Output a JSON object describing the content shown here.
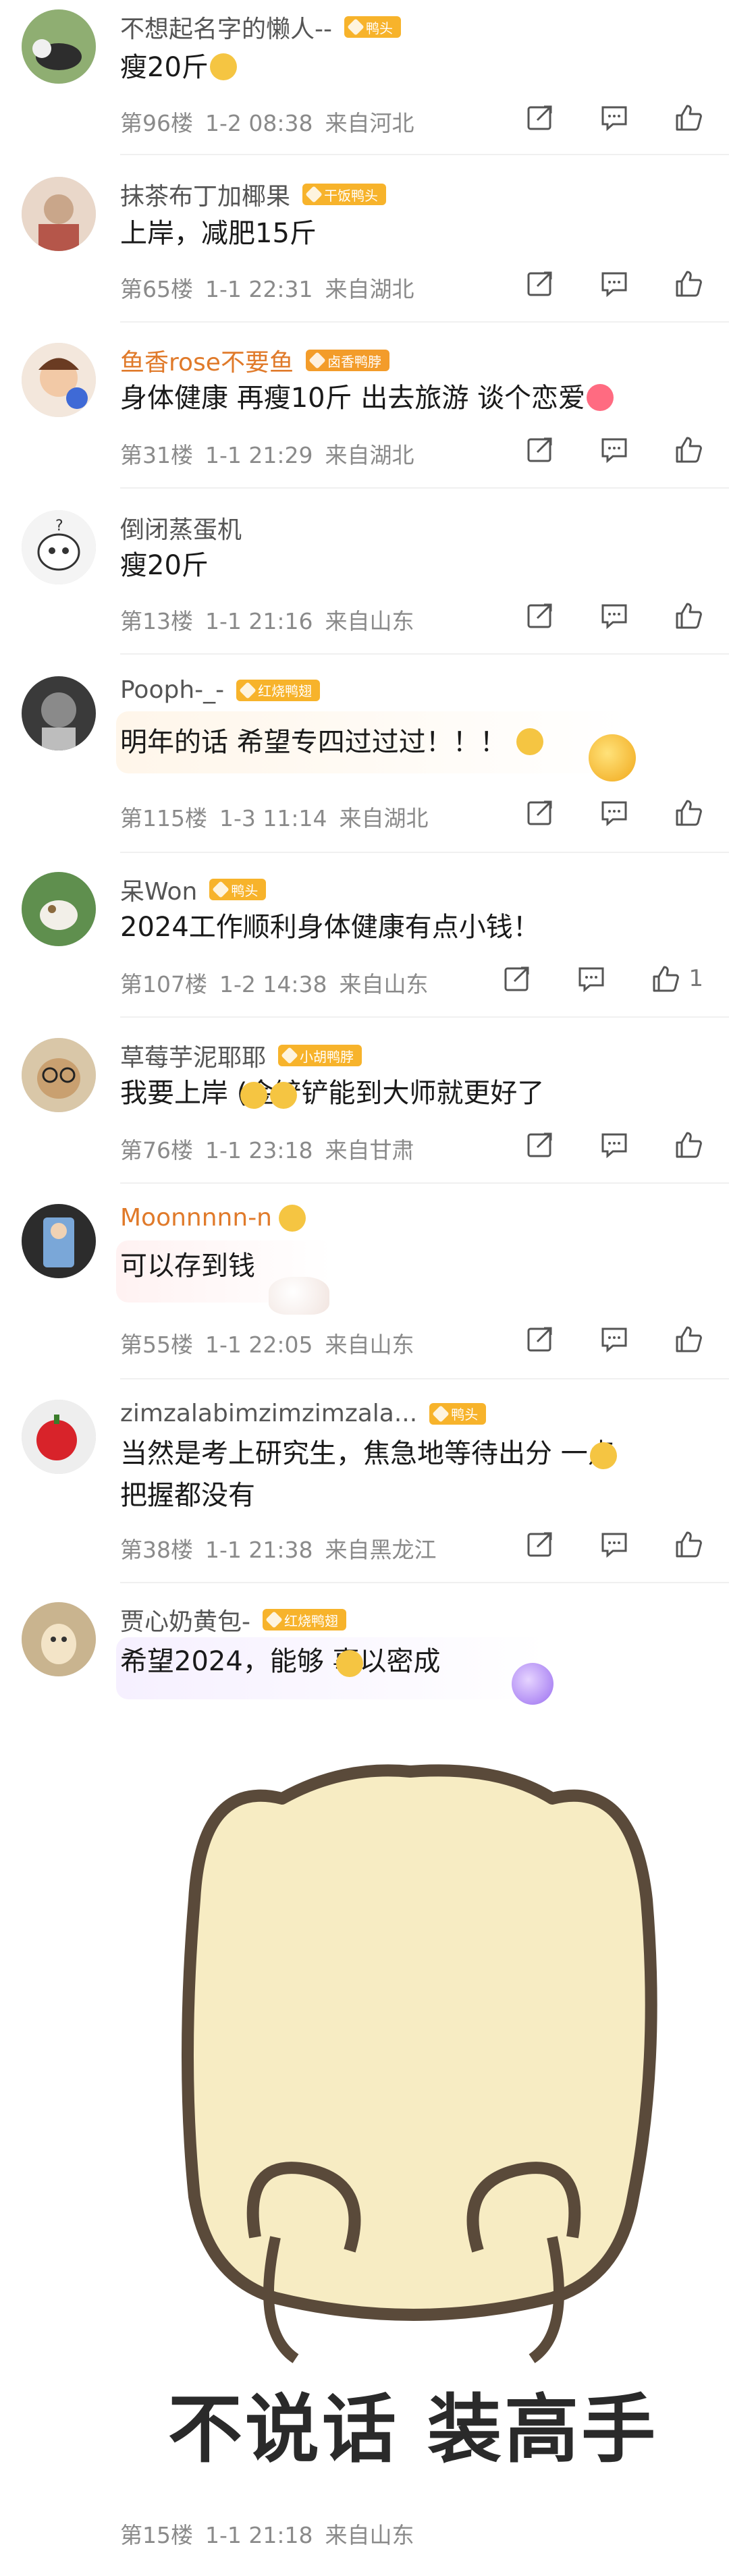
{
  "colors": {
    "meta": "#8a8a8a",
    "badge": "#f7b32b",
    "orange_name": "#e07a2a"
  },
  "comments": [
    {
      "name": "不想起名字的懒人--",
      "badge": "鸭头",
      "text": "瘦20斤",
      "floor": "第96楼",
      "time": "1-2 08:38",
      "location": "来自河北",
      "likes": ""
    },
    {
      "name": "抹茶布丁加椰果",
      "badge": "干饭鸭头",
      "text": "上岸，减肥15斤",
      "floor": "第65楼",
      "time": "1-1 22:31",
      "location": "来自湖北",
      "likes": ""
    },
    {
      "name": "鱼香rose不要鱼",
      "badge": "卤香鸭脖",
      "text": "身体健康 再瘦10斤 出去旅游 谈个恋爱",
      "floor": "第31楼",
      "time": "1-1 21:29",
      "location": "来自湖北",
      "likes": ""
    },
    {
      "name": "倒闭蒸蛋机",
      "badge": "",
      "text": "瘦20斤",
      "floor": "第13楼",
      "time": "1-1 21:16",
      "location": "来自山东",
      "likes": ""
    },
    {
      "name": "Pooph-_-",
      "badge": "红烧鸭翅",
      "text": "明年的话 希望专四过过过！！！",
      "floor": "第115楼",
      "time": "1-3 11:14",
      "location": "来自湖北",
      "likes": ""
    },
    {
      "name": "呆Won",
      "badge": "鸭头",
      "text": "2024工作顺利身体健康有点小钱！",
      "floor": "第107楼",
      "time": "1-2 14:38",
      "location": "来自山东",
      "likes": "1"
    },
    {
      "name": "草莓芋泥耶耶",
      "badge": "小胡鸭脖",
      "text": "我要上岸  (金铲铲能到大师就更好了",
      "floor": "第76楼",
      "time": "1-1 23:18",
      "location": "来自甘肃",
      "likes": ""
    },
    {
      "name": "Moonnnnn-n",
      "badge": "",
      "text": "可以存到钱",
      "floor": "第55楼",
      "time": "1-1 22:05",
      "location": "来自山东",
      "likes": ""
    },
    {
      "name": "zimzalabimzimzimzala...",
      "badge": "鸭头",
      "text": "当然是考上研究生，焦急地等待出分 一点",
      "text2": "把握都没有",
      "floor": "第38楼",
      "time": "1-1 21:38",
      "location": "来自黑龙江",
      "likes": ""
    },
    {
      "name": "贾心奶黄包-",
      "badge": "红烧鸭翅",
      "text": "希望2024，能够 事以密成",
      "floor": "第15楼",
      "time": "1-1 21:18",
      "location": "来自山东",
      "likes": "",
      "image_caption": "不说话 装高手"
    }
  ]
}
